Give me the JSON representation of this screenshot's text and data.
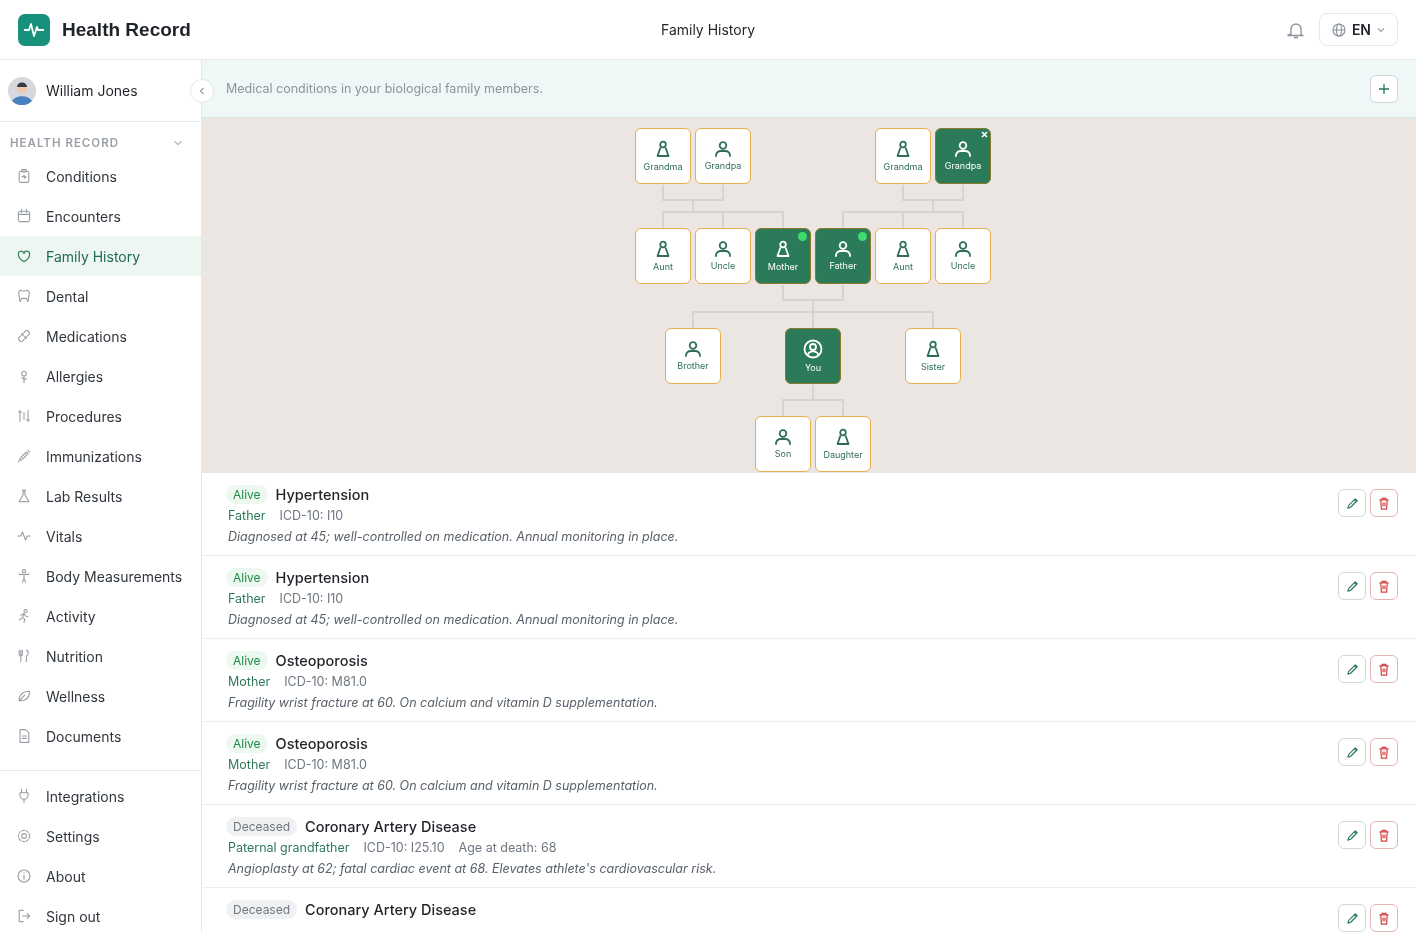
{
  "app": {
    "title": "Health Record"
  },
  "header": {
    "title": "Family History",
    "language": "EN"
  },
  "user": {
    "name": "William Jones"
  },
  "sidebar": {
    "section": "HEALTH RECORD",
    "expanded": true,
    "items": [
      {
        "label": "Conditions",
        "selected": false
      },
      {
        "label": "Encounters",
        "selected": false
      },
      {
        "label": "Family History",
        "selected": true
      },
      {
        "label": "Dental",
        "selected": false
      },
      {
        "label": "Medications",
        "selected": false
      },
      {
        "label": "Allergies",
        "selected": false
      },
      {
        "label": "Procedures",
        "selected": false
      },
      {
        "label": "Immunizations",
        "selected": false
      },
      {
        "label": "Lab Results",
        "selected": false
      },
      {
        "label": "Vitals",
        "selected": false
      },
      {
        "label": "Body Measurements",
        "selected": false
      },
      {
        "label": "Activity",
        "selected": false
      },
      {
        "label": "Nutrition",
        "selected": false
      },
      {
        "label": "Wellness",
        "selected": false
      },
      {
        "label": "Documents",
        "selected": false
      }
    ],
    "footer_items": [
      {
        "label": "Integrations"
      },
      {
        "label": "Settings"
      },
      {
        "label": "About"
      },
      {
        "label": "Sign out"
      }
    ]
  },
  "banner": {
    "text": "Medical conditions in your biological family members."
  },
  "tree": {
    "nodes": [
      {
        "label": "Grandma",
        "kind": "female",
        "selected": false,
        "has_conditions": false,
        "removable": false
      },
      {
        "label": "Grandpa",
        "kind": "male",
        "selected": false,
        "has_conditions": false,
        "removable": false
      },
      {
        "label": "Grandma",
        "kind": "female",
        "selected": false,
        "has_conditions": false,
        "removable": false
      },
      {
        "label": "Grandpa",
        "kind": "male",
        "selected": true,
        "has_conditions": false,
        "removable": true
      },
      {
        "label": "Aunt",
        "kind": "female",
        "selected": false,
        "has_conditions": false,
        "removable": false
      },
      {
        "label": "Uncle",
        "kind": "male",
        "selected": false,
        "has_conditions": false,
        "removable": false
      },
      {
        "label": "Mother",
        "kind": "female",
        "selected": true,
        "has_conditions": true,
        "removable": false
      },
      {
        "label": "Father",
        "kind": "male",
        "selected": true,
        "has_conditions": true,
        "removable": false
      },
      {
        "label": "Aunt",
        "kind": "female",
        "selected": false,
        "has_conditions": false,
        "removable": false
      },
      {
        "label": "Uncle",
        "kind": "male",
        "selected": false,
        "has_conditions": false,
        "removable": false
      },
      {
        "label": "Brother",
        "kind": "male",
        "selected": false,
        "has_conditions": false,
        "removable": false
      },
      {
        "label": "You",
        "kind": "self",
        "selected": true,
        "has_conditions": false,
        "removable": false
      },
      {
        "label": "Sister",
        "kind": "female",
        "selected": false,
        "has_conditions": false,
        "removable": false
      },
      {
        "label": "Son",
        "kind": "male",
        "selected": false,
        "has_conditions": false,
        "removable": false
      },
      {
        "label": "Daughter",
        "kind": "female",
        "selected": false,
        "has_conditions": false,
        "removable": false
      }
    ]
  },
  "conditions": [
    {
      "status": "Alive",
      "kind": "alive",
      "name": "Hypertension",
      "relation": "Father",
      "code": "ICD-10: I10",
      "note": "Diagnosed at 45; well-controlled on medication. Annual monitoring in place."
    },
    {
      "status": "Alive",
      "kind": "alive",
      "name": "Hypertension",
      "relation": "Father",
      "code": "ICD-10: I10",
      "note": "Diagnosed at 45; well-controlled on medication. Annual monitoring in place."
    },
    {
      "status": "Alive",
      "kind": "alive",
      "name": "Osteoporosis",
      "relation": "Mother",
      "code": "ICD-10: M81.0",
      "note": "Fragility wrist fracture at 60. On calcium and vitamin D supplementation."
    },
    {
      "status": "Alive",
      "kind": "alive",
      "name": "Osteoporosis",
      "relation": "Mother",
      "code": "ICD-10: M81.0",
      "note": "Fragility wrist fracture at 60. On calcium and vitamin D supplementation."
    },
    {
      "status": "Deceased",
      "kind": "deceased",
      "name": "Coronary Artery Disease",
      "relation": "Paternal grandfather",
      "code": "ICD-10: I25.10",
      "age_at_death": "Age at death: 68",
      "note": "Angioplasty at 62; fatal cardiac event at 68. Elevates athlete's cardiovascular risk."
    },
    {
      "status": "Deceased",
      "kind": "deceased",
      "name": "Coronary Artery Disease"
    }
  ]
}
